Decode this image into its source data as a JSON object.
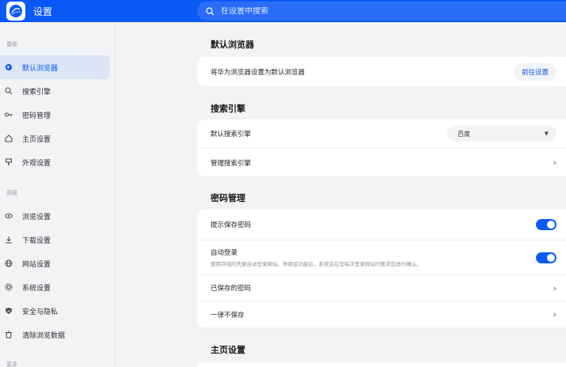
{
  "app": {
    "title": "设置",
    "logo_icon": "browser-logo-icon"
  },
  "search": {
    "placeholder": "在设置中搜索",
    "icon": "search-icon"
  },
  "colors": {
    "accent": "#0a59f7",
    "active_bg": "#dbe5f5"
  },
  "sidebar": {
    "groups": [
      {
        "label": "基础",
        "items": [
          {
            "label": "默认浏览器",
            "icon": "globe-icon",
            "active": true
          },
          {
            "label": "搜索引擎",
            "icon": "search-icon"
          },
          {
            "label": "密码管理",
            "icon": "key-icon"
          },
          {
            "label": "主页设置",
            "icon": "home-icon"
          },
          {
            "label": "外观设置",
            "icon": "appearance-icon"
          }
        ]
      },
      {
        "label": "高级",
        "items": [
          {
            "label": "浏览设置",
            "icon": "eye-icon"
          },
          {
            "label": "下载设置",
            "icon": "download-icon"
          },
          {
            "label": "网站设置",
            "icon": "globe-icon"
          },
          {
            "label": "系统设置",
            "icon": "gear-icon"
          },
          {
            "label": "安全与隐私",
            "icon": "shield-icon"
          },
          {
            "label": "清除浏览数据",
            "icon": "trash-icon"
          }
        ]
      },
      {
        "label": "更多",
        "items": []
      }
    ]
  },
  "main": {
    "default_browser": {
      "title": "默认浏览器",
      "row_label": "将华为浏览器设置为默认浏览器",
      "button_label": "前往设置"
    },
    "search_engine": {
      "title": "搜索引擎",
      "default_label": "默认搜索引擎",
      "selected": "百度",
      "manage_label": "管理搜索引擎"
    },
    "password": {
      "title": "密码管理",
      "offer_save_label": "提示保存密码",
      "offer_save_on": true,
      "auto_login_label": "自动登录",
      "auto_login_desc": "使用存储的凭据自动登录网站。停用该功能后，系统会在您每次登录网站时要求您进行确认。",
      "auto_login_on": true,
      "saved_label": "已保存的密码",
      "never_label": "一律不保存"
    },
    "homepage": {
      "title": "主页设置"
    }
  }
}
